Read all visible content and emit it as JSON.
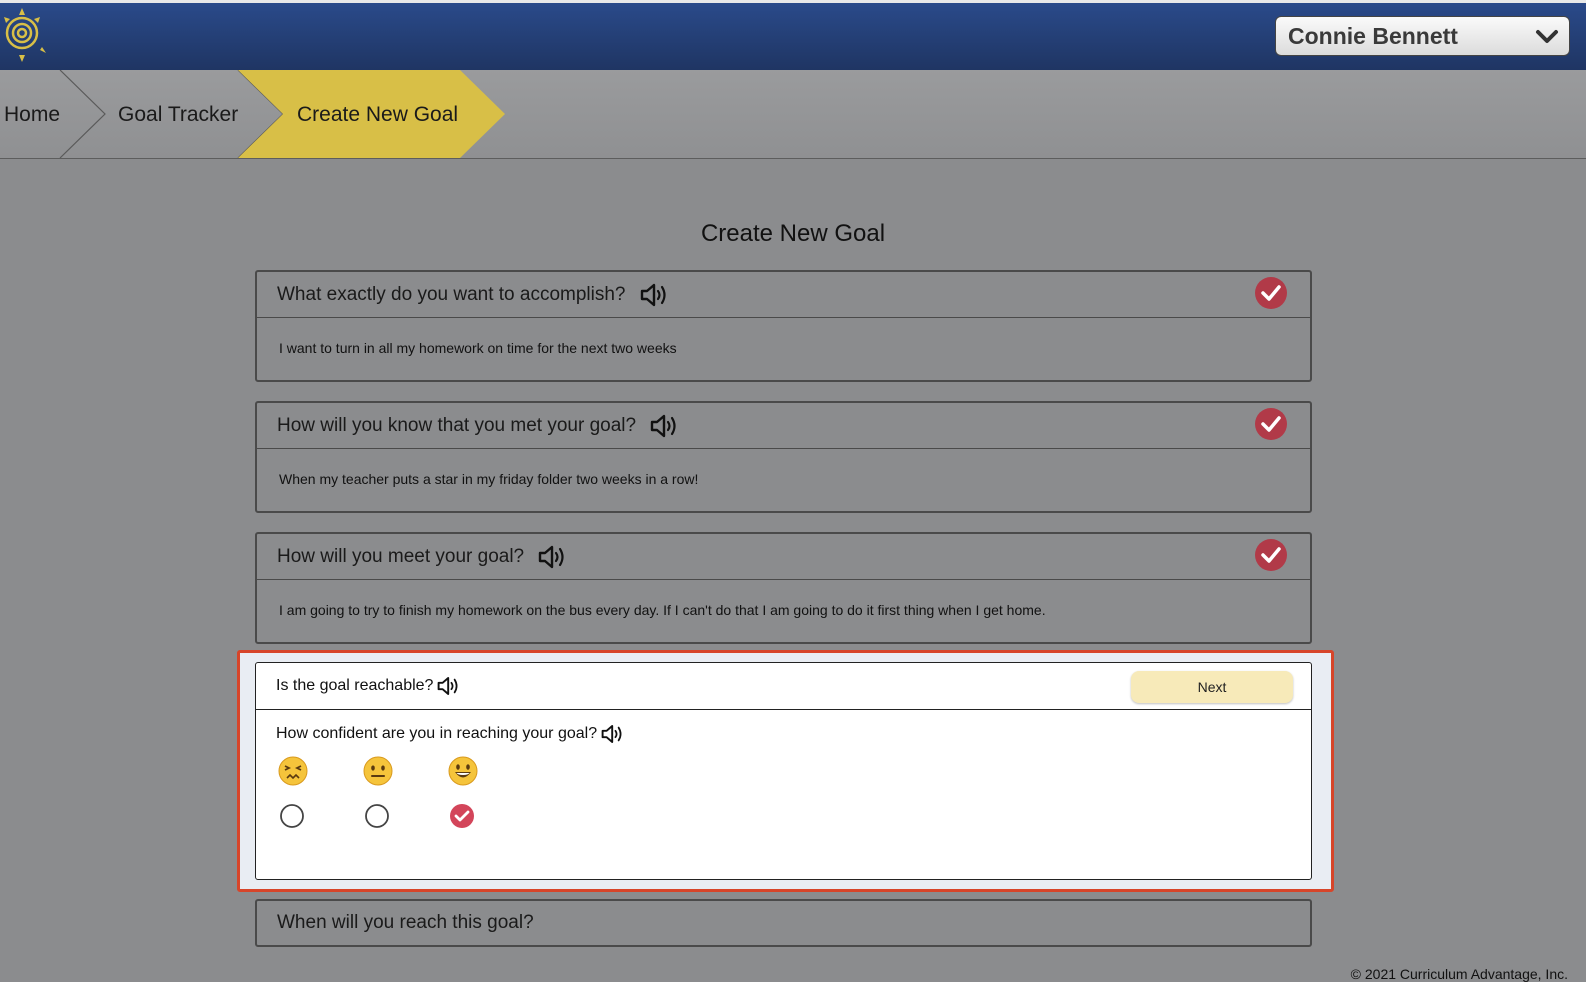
{
  "header": {
    "user_name": "Connie Bennett",
    "brand_color": "#1f3563"
  },
  "breadcrumb": {
    "items": [
      {
        "label": "Home",
        "active": false
      },
      {
        "label": "Goal Tracker",
        "active": false
      },
      {
        "label": "Create New Goal",
        "active": true
      }
    ],
    "active_color": "#d8bf47"
  },
  "page": {
    "title": "Create New Goal"
  },
  "questions": [
    {
      "question": "What exactly do you want to accomplish?",
      "answer": "I want to turn in all my homework on time for the next two weeks",
      "completed": true
    },
    {
      "question": "How will you know that you met your goal?",
      "answer": "When my teacher puts a star in my friday folder two weeks in a row!",
      "completed": true
    },
    {
      "question": "How will you meet your goal?",
      "answer": "I am going to try to finish my homework on the bus every day. If I can't do that I am going to do it first thing when I get home.",
      "completed": true
    }
  ],
  "active_step": {
    "question": "Is the goal reachable?",
    "next_label": "Next",
    "confidence_question": "How confident are you in reaching your goal?",
    "options": [
      {
        "emoji": "😣",
        "icon": "persevering-face-icon",
        "selected": false
      },
      {
        "emoji": "😐",
        "icon": "neutral-face-icon",
        "selected": false
      },
      {
        "emoji": "😃",
        "icon": "grinning-face-icon",
        "selected": true
      }
    ],
    "highlight_color": "#d7452a"
  },
  "next_question": {
    "question": "When will you reach this goal?"
  },
  "footer": {
    "copyright": "© 2021 Curriculum Advantage, Inc."
  },
  "colors": {
    "check_badge": "#b13a48",
    "next_button": "#f7eab9"
  }
}
